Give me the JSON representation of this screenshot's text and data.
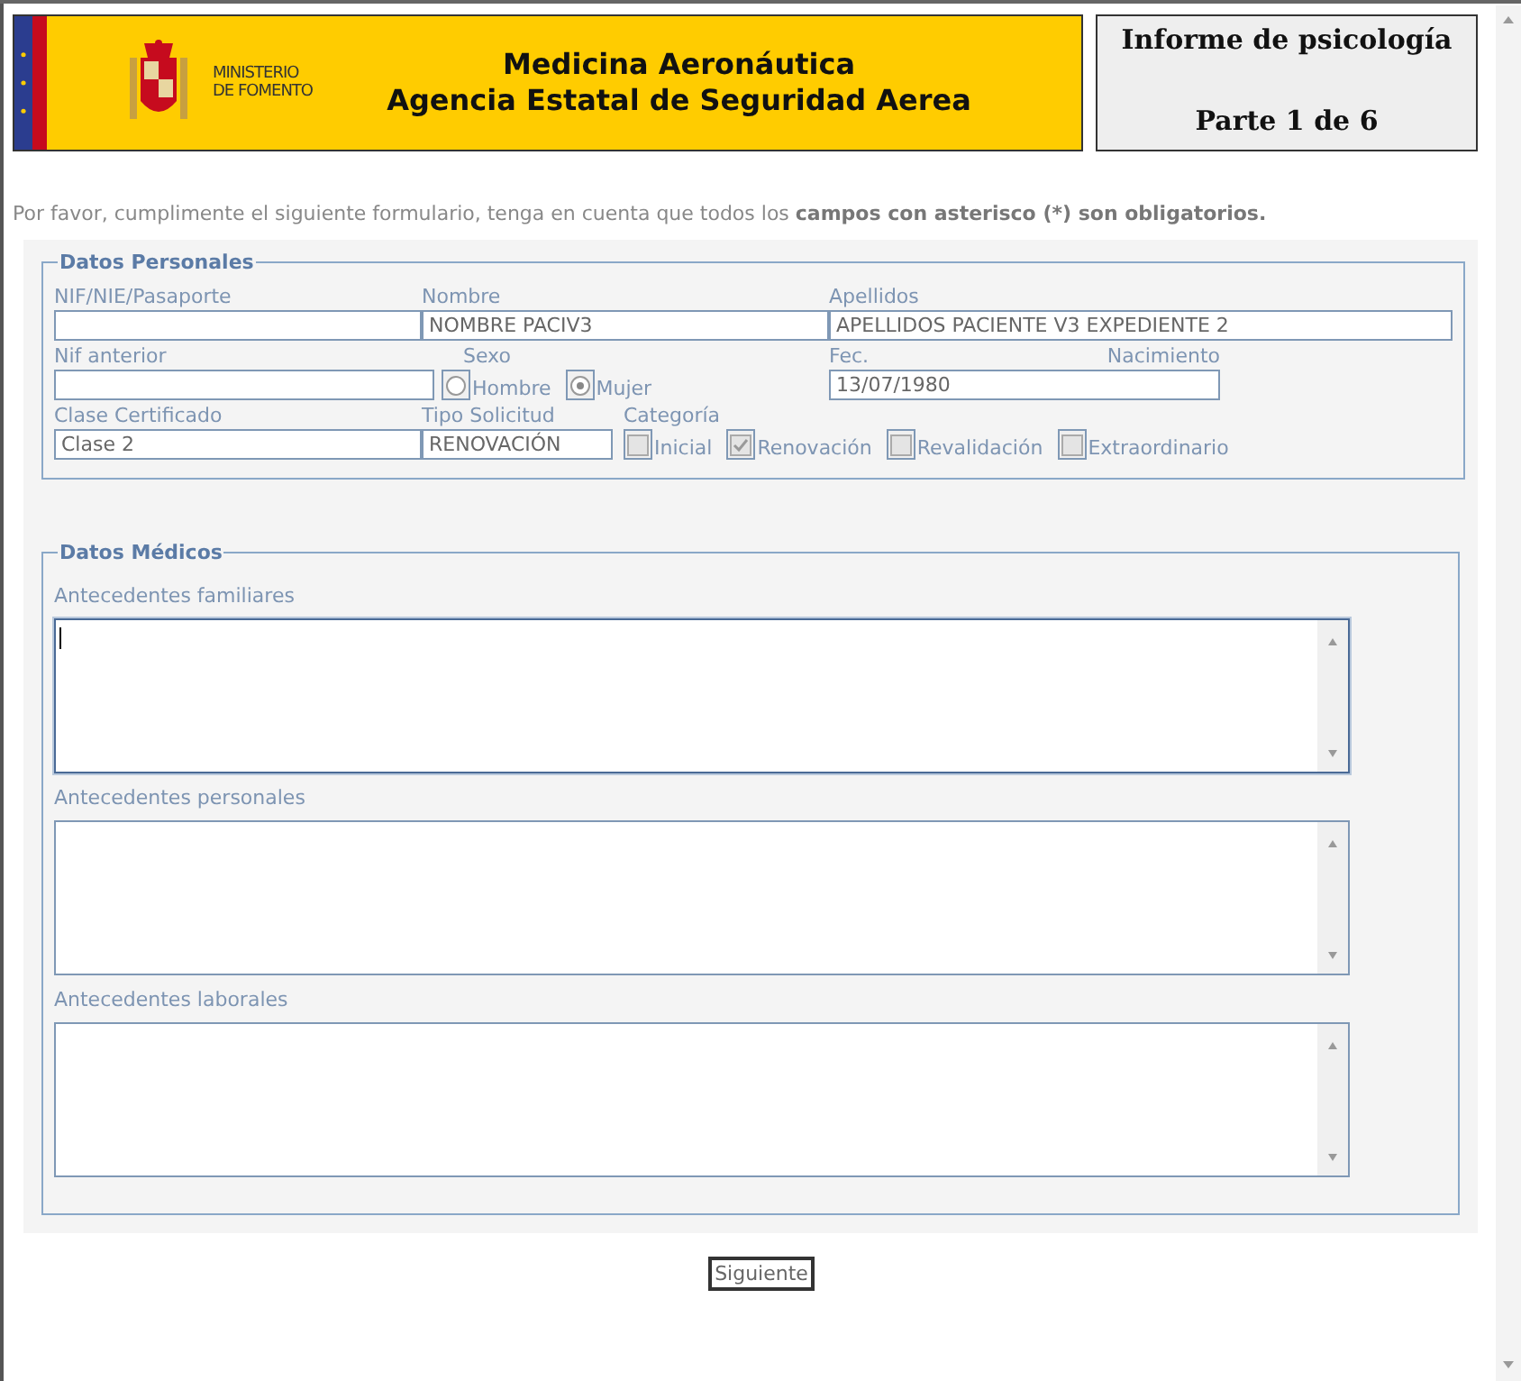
{
  "header": {
    "ministry_lines": [
      "MINISTERIO",
      "DE FOMENTO"
    ],
    "title_lines": [
      "Medicina Aeronáutica",
      "Agencia Estatal de Seguridad Aerea"
    ]
  },
  "report": {
    "title": "Informe de psicología",
    "part": "Parte 1 de 6"
  },
  "intro": "Por favor, cumplimente el siguiente formulario, tenga en cuenta que todos los **campos con asterisco (*) son obligatorios.**",
  "personal": {
    "legend": "Datos Personales",
    "rows": [
      [
        {
          "kind": "text",
          "label": "NIF/NIE/Pasaporte"
        },
        {
          "kind": "text",
          "label": "Nombre",
          "value": "NOMBRE PACIV3"
        },
        {
          "kind": "text",
          "label": "Apellidos",
          "value": "APELLIDOS PACIENTE V3 EXPEDIENTE 2"
        }
      ],
      [
        {
          "kind": "text",
          "label": "Nif anterior"
        },
        {
          "kind": "radio",
          "label": "Sexo",
          "options": [
            {
              "label": "Hombre",
              "selected": false
            },
            {
              "label": "Mujer",
              "selected": true
            }
          ]
        },
        {
          "kind": "date",
          "labels": [
            "Fec.",
            "Nacimiento"
          ],
          "value": "13/07/1980"
        }
      ],
      [
        {
          "kind": "text",
          "label": "Clase Certificado",
          "value": "Clase 2"
        },
        {
          "kind": "text",
          "label": "Tipo Solicitud",
          "value": "RENOVACIÓN"
        },
        {
          "kind": "checks",
          "label": "Categoría",
          "options": [
            {
              "label": "Inicial",
              "checked": false
            },
            {
              "label": "Renovación",
              "checked": true
            },
            {
              "label": "Revalidación",
              "checked": false
            },
            {
              "label": "Extraordinario",
              "checked": false
            }
          ]
        }
      ]
    ]
  },
  "medical": {
    "legend": "Datos Médicos",
    "fields": [
      {
        "label": "Antecedentes familiares",
        "focused": true
      },
      {
        "label": "Antecedentes personales",
        "focused": false
      },
      {
        "label": "Antecedentes laborales",
        "focused": false
      }
    ]
  },
  "next_button": "Siguiente"
}
